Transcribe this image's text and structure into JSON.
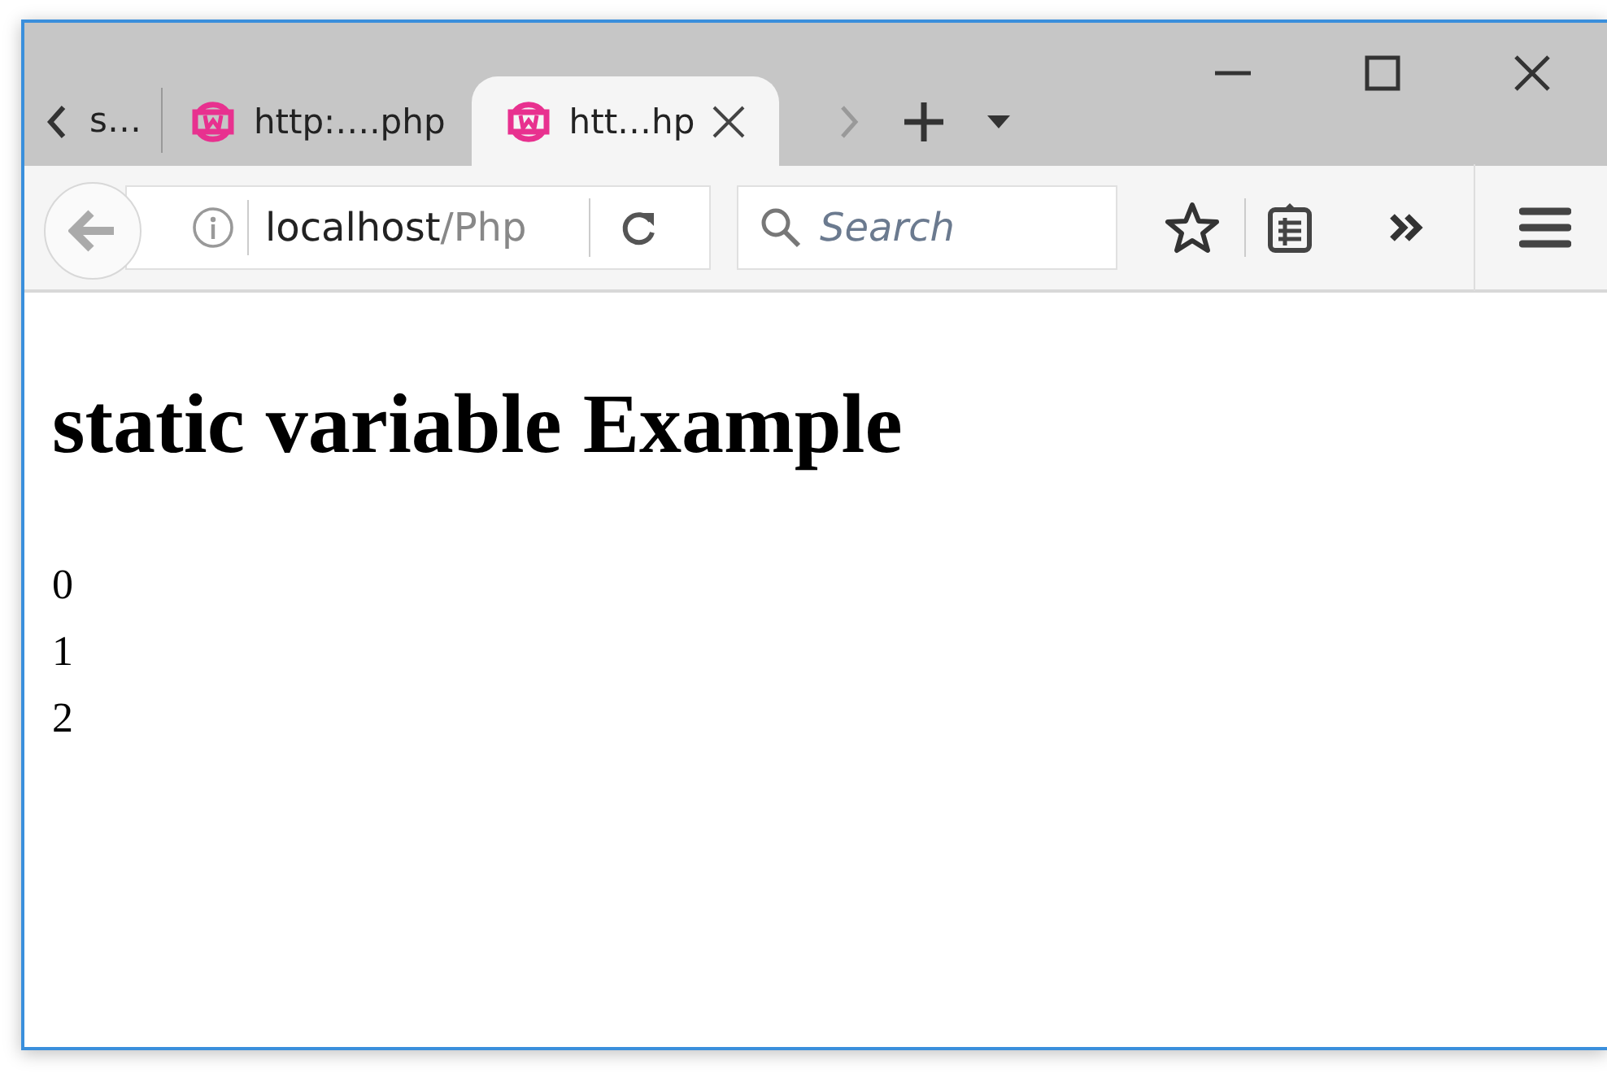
{
  "tabs": [
    {
      "label": "s…",
      "selected": false
    },
    {
      "label": "http:….php",
      "selected": false
    },
    {
      "label": "htt…hp",
      "selected": true
    }
  ],
  "address_bar": {
    "host": "localhost",
    "path": "/Php"
  },
  "search": {
    "placeholder": "Search"
  },
  "page": {
    "heading": "static variable Example",
    "lines": [
      "0",
      "1",
      "2"
    ]
  }
}
